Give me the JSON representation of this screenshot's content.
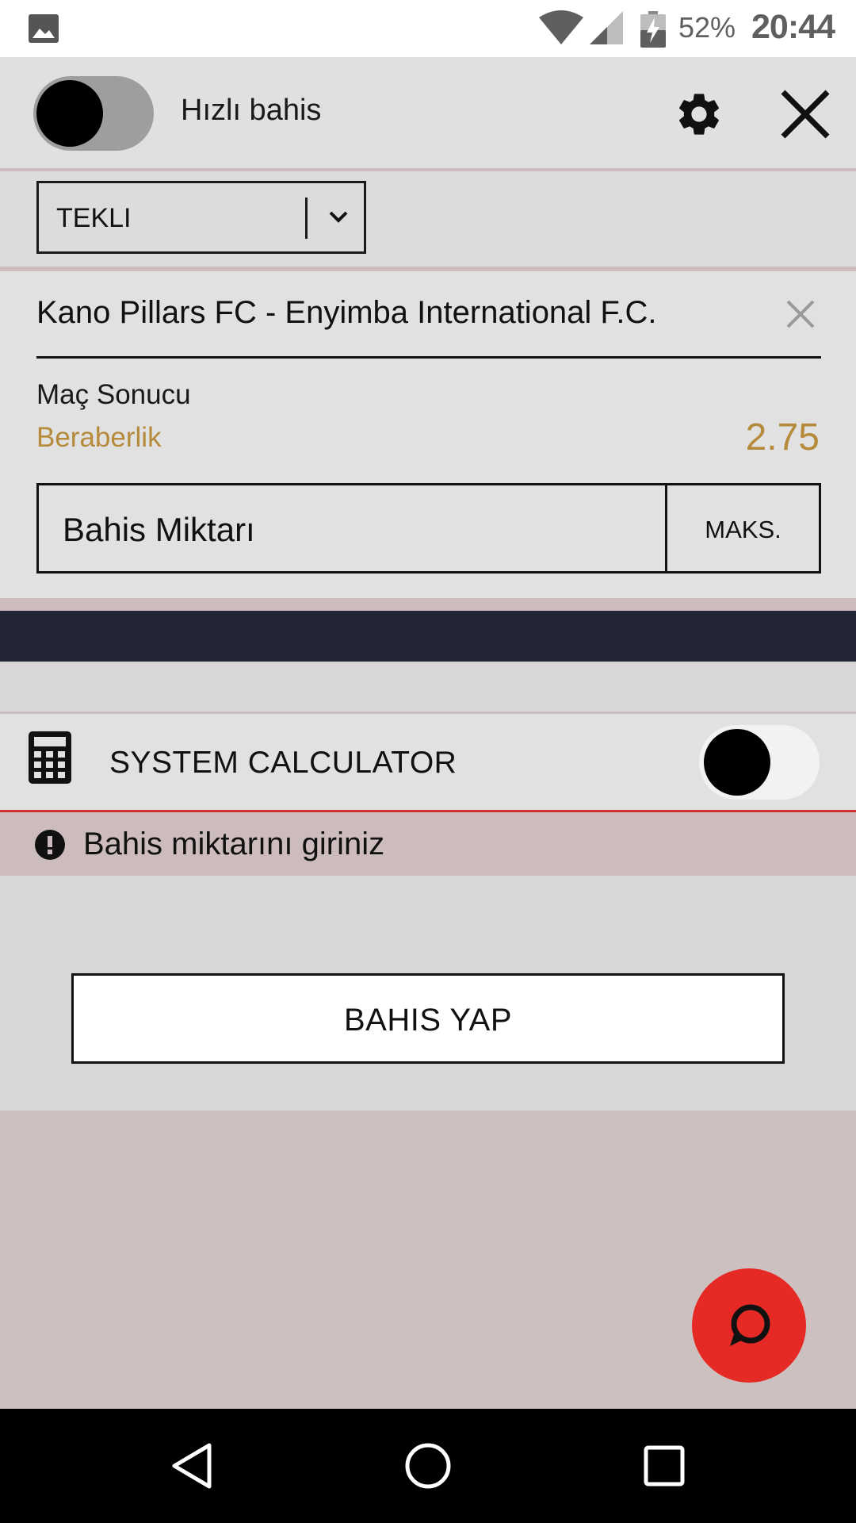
{
  "status_bar": {
    "battery": "52%",
    "time": "20:44",
    "icons": [
      "image-icon",
      "wifi-icon",
      "signal-icon",
      "battery-charging-icon"
    ]
  },
  "header": {
    "quick_bet_label": "Hızlı bahis",
    "quick_bet_enabled": false,
    "icons": [
      "gear-icon",
      "close-icon"
    ]
  },
  "bet_type": {
    "selected": "TEKLI"
  },
  "bet": {
    "match": "Kano Pillars FC - Enyimba International F.C.",
    "market": "Maç Sonucu",
    "selection": "Beraberlik",
    "odds": "2.75",
    "stake_placeholder": "Bahis Miktarı",
    "max_label": "MAKS."
  },
  "system_calculator": {
    "label": "SYSTEM CALCULATOR",
    "enabled": false
  },
  "warning": {
    "text": "Bahis miktarını giriniz"
  },
  "actions": {
    "place_bet_label": "BAHIS YAP"
  },
  "colors": {
    "accent_gold": "#b58a3b",
    "fab_red": "#e52a26",
    "warning_band": "#cdbcbd",
    "dark_bar": "#222533"
  }
}
